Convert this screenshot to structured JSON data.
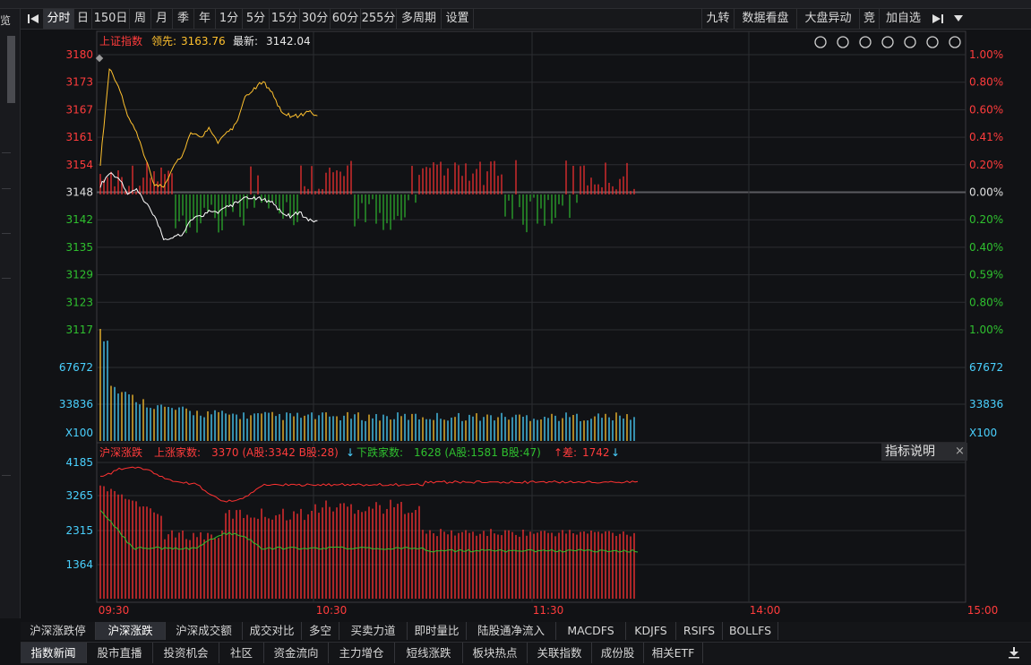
{
  "left_strip": {
    "label": "览"
  },
  "toolbar": {
    "items": [
      "分时",
      "日",
      "150日",
      "周",
      "月",
      "季",
      "年",
      "1分",
      "5分",
      "15分",
      "30分",
      "60分",
      "255分",
      "多周期",
      "设置"
    ],
    "right_items": [
      "九转",
      "数据看盘",
      "大盘异动",
      "竞",
      "加自选"
    ]
  },
  "legend": {
    "name": "上证指数",
    "lead_label": "领先:",
    "lead_value": "3163.76",
    "latest_label": "最新:",
    "latest_value": "3142.04"
  },
  "price_axis": {
    "left": [
      "3180",
      "3173",
      "3167",
      "3161",
      "3154",
      "3148",
      "3142",
      "3135",
      "3129",
      "3123",
      "3117"
    ],
    "right": [
      "1.00%",
      "0.80%",
      "0.60%",
      "0.41%",
      "0.20%",
      "0.00%",
      "0.20%",
      "0.40%",
      "0.59%",
      "0.80%",
      "1.00%"
    ]
  },
  "volume_axis": {
    "left": [
      "67672",
      "33836",
      "X100"
    ],
    "right": [
      "67672",
      "33836",
      "X100"
    ]
  },
  "breadth": {
    "title": "沪深涨跌",
    "up_label": "上涨家数:",
    "up_text": "3370 (A股:3342 B股:28)",
    "down_label": "下跌家数:",
    "down_text": "1628 (A股:1581 B股:47)",
    "diff_label": "差:",
    "diff_value": "1742",
    "axis": [
      "4185",
      "3265",
      "2315",
      "1364"
    ]
  },
  "help": {
    "label": "指标说明",
    "close": "×"
  },
  "time_axis": [
    "09:30",
    "10:30",
    "11:30",
    "14:00",
    "15:00"
  ],
  "tabs_row1": [
    "沪深涨跌停",
    "沪深涨跌",
    "沪深成交额",
    "成交对比",
    "多空",
    "买卖力道",
    "即时量比",
    "陆股通净流入",
    "MACDFS",
    "KDJFS",
    "RSIFS",
    "BOLLFS"
  ],
  "tabs_row1_active": 1,
  "tabs_row2": [
    "指数新闻",
    "股市直播",
    "投资机会",
    "社区",
    "资金流向",
    "主力增仓",
    "短线涨跌",
    "板块热点",
    "关联指数",
    "成份股",
    "相关ETF"
  ],
  "tabs_row2_active": 0,
  "colors": {
    "up": "#ff3232",
    "down": "#2fb52f",
    "white_line": "#ffffff",
    "yellow_line": "#ffc12e",
    "label_blue": "#4ad1ff",
    "bg": "#111215"
  },
  "chart_data": {
    "type": "line",
    "title": "上证指数",
    "x_range": [
      "09:30",
      "15:00"
    ],
    "ylim": [
      3117,
      3180
    ],
    "base": 3148,
    "series": [
      {
        "name": "最新",
        "x_minutes": [
          0,
          5,
          10,
          15,
          20,
          25,
          30,
          35,
          40,
          45,
          50,
          55,
          60,
          65,
          70,
          75,
          80,
          85,
          90,
          95,
          100,
          105,
          110,
          115,
          120
        ],
        "values": [
          3150,
          3153,
          3152,
          3148,
          3149,
          3146,
          3143,
          3138,
          3138,
          3139,
          3142,
          3143,
          3144,
          3144,
          3145,
          3146,
          3147,
          3147,
          3147,
          3146,
          3144,
          3143,
          3144,
          3142,
          3142
        ]
      },
      {
        "name": "领先",
        "x_minutes": [
          0,
          5,
          10,
          15,
          20,
          25,
          30,
          35,
          40,
          45,
          50,
          55,
          60,
          65,
          70,
          75,
          80,
          85,
          90,
          95,
          100,
          105,
          110,
          115,
          120
        ],
        "values": [
          3155,
          3177,
          3173,
          3166,
          3162,
          3156,
          3150,
          3150,
          3154,
          3157,
          3162,
          3161,
          3163,
          3160,
          3162,
          3164,
          3170,
          3172,
          3174,
          3171,
          3167,
          3166,
          3166,
          3167,
          3166
        ]
      }
    ]
  }
}
